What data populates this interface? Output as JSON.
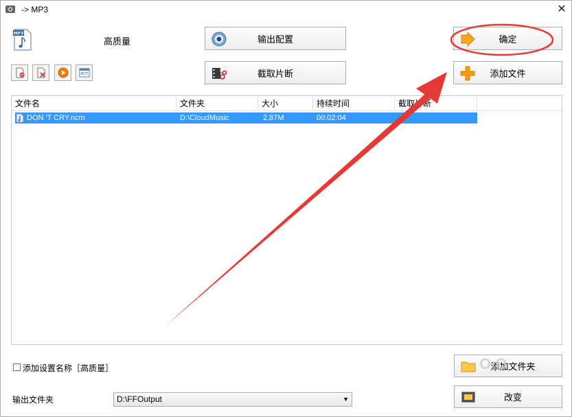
{
  "window": {
    "title": "-> MP3",
    "close_glyph": "✕"
  },
  "header": {
    "format_icon": "mp3-file-icon",
    "quality_label": "高质量"
  },
  "buttons": {
    "output_config": "输出配置",
    "clip": "截取片断",
    "ok": "确定",
    "add_file": "添加文件",
    "add_folder": "添加文件夹",
    "change": "改变"
  },
  "toolbar": [
    "remove-file-icon",
    "clear-list-icon",
    "play-icon",
    "media-info-icon"
  ],
  "list": {
    "columns": [
      "文件名",
      "文件夹",
      "大小",
      "持续时间",
      "截取片断"
    ],
    "rows": [
      {
        "name": "DON 'T CRY.ncm",
        "folder": "D:\\CloudMusic",
        "size": "2.87M",
        "duration": "00:02:04",
        "clip": ""
      }
    ]
  },
  "options": {
    "add_setting_name_label": "添加设置名称［高质量］",
    "add_setting_name_checked": false
  },
  "output": {
    "label": "输出文件夹",
    "path": "D:\\FFOutput"
  },
  "colors": {
    "selection": "#3399ff",
    "annotation": "#e53935"
  }
}
